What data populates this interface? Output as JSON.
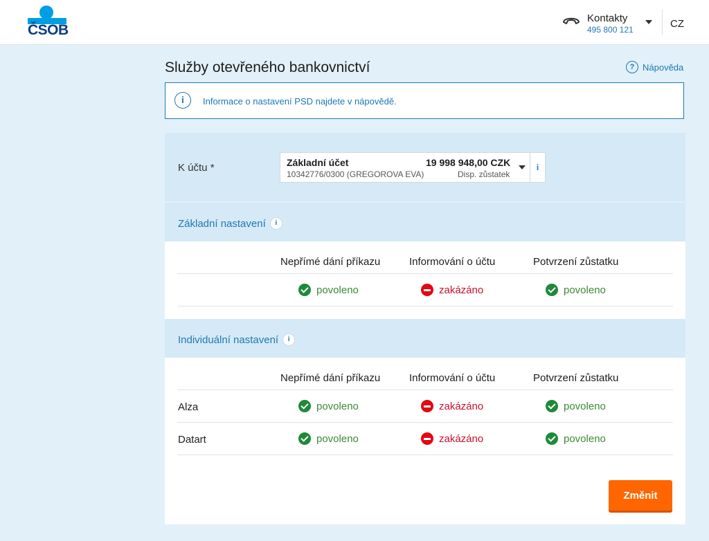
{
  "header": {
    "logo_text": "ČSOB",
    "contact_label": "Kontakty",
    "contact_phone": "495 800 121",
    "language": "CZ",
    "icons": {
      "phone": "phone-icon",
      "caret": "chevron-down-icon"
    }
  },
  "page": {
    "title": "Služby otevřeného bankovnictví",
    "help_label": "Nápověda",
    "info_text": "Informace o nastavení PSD najdete v nápovědě."
  },
  "account": {
    "label": "K účtu *",
    "name": "Základní účet",
    "balance": "19 998 948,00 CZK",
    "number": "10342776/0300 (GREGOROVA EVA)",
    "balance_type": "Disp. zůstatek",
    "info": "i"
  },
  "columns": [
    "Nepřímé dání příkazu",
    "Informování o účtu",
    "Potvrzení zůstatku"
  ],
  "basic": {
    "title": "Základní nastavení",
    "statuses": [
      "povoleno",
      "zakázáno",
      "povoleno"
    ]
  },
  "individual": {
    "title": "Individuální nastavení",
    "rows": [
      {
        "name": "Alza",
        "statuses": [
          "povoleno",
          "zakázáno",
          "povoleno"
        ]
      },
      {
        "name": "Datart",
        "statuses": [
          "povoleno",
          "zakázáno",
          "povoleno"
        ]
      }
    ]
  },
  "actions": {
    "change_label": "Změnit"
  },
  "colors": {
    "accent": "#1e78b4",
    "brand": "#009fe3",
    "button": "#ff6600",
    "allowed": "#1d8a3a",
    "denied": "#e30613"
  }
}
